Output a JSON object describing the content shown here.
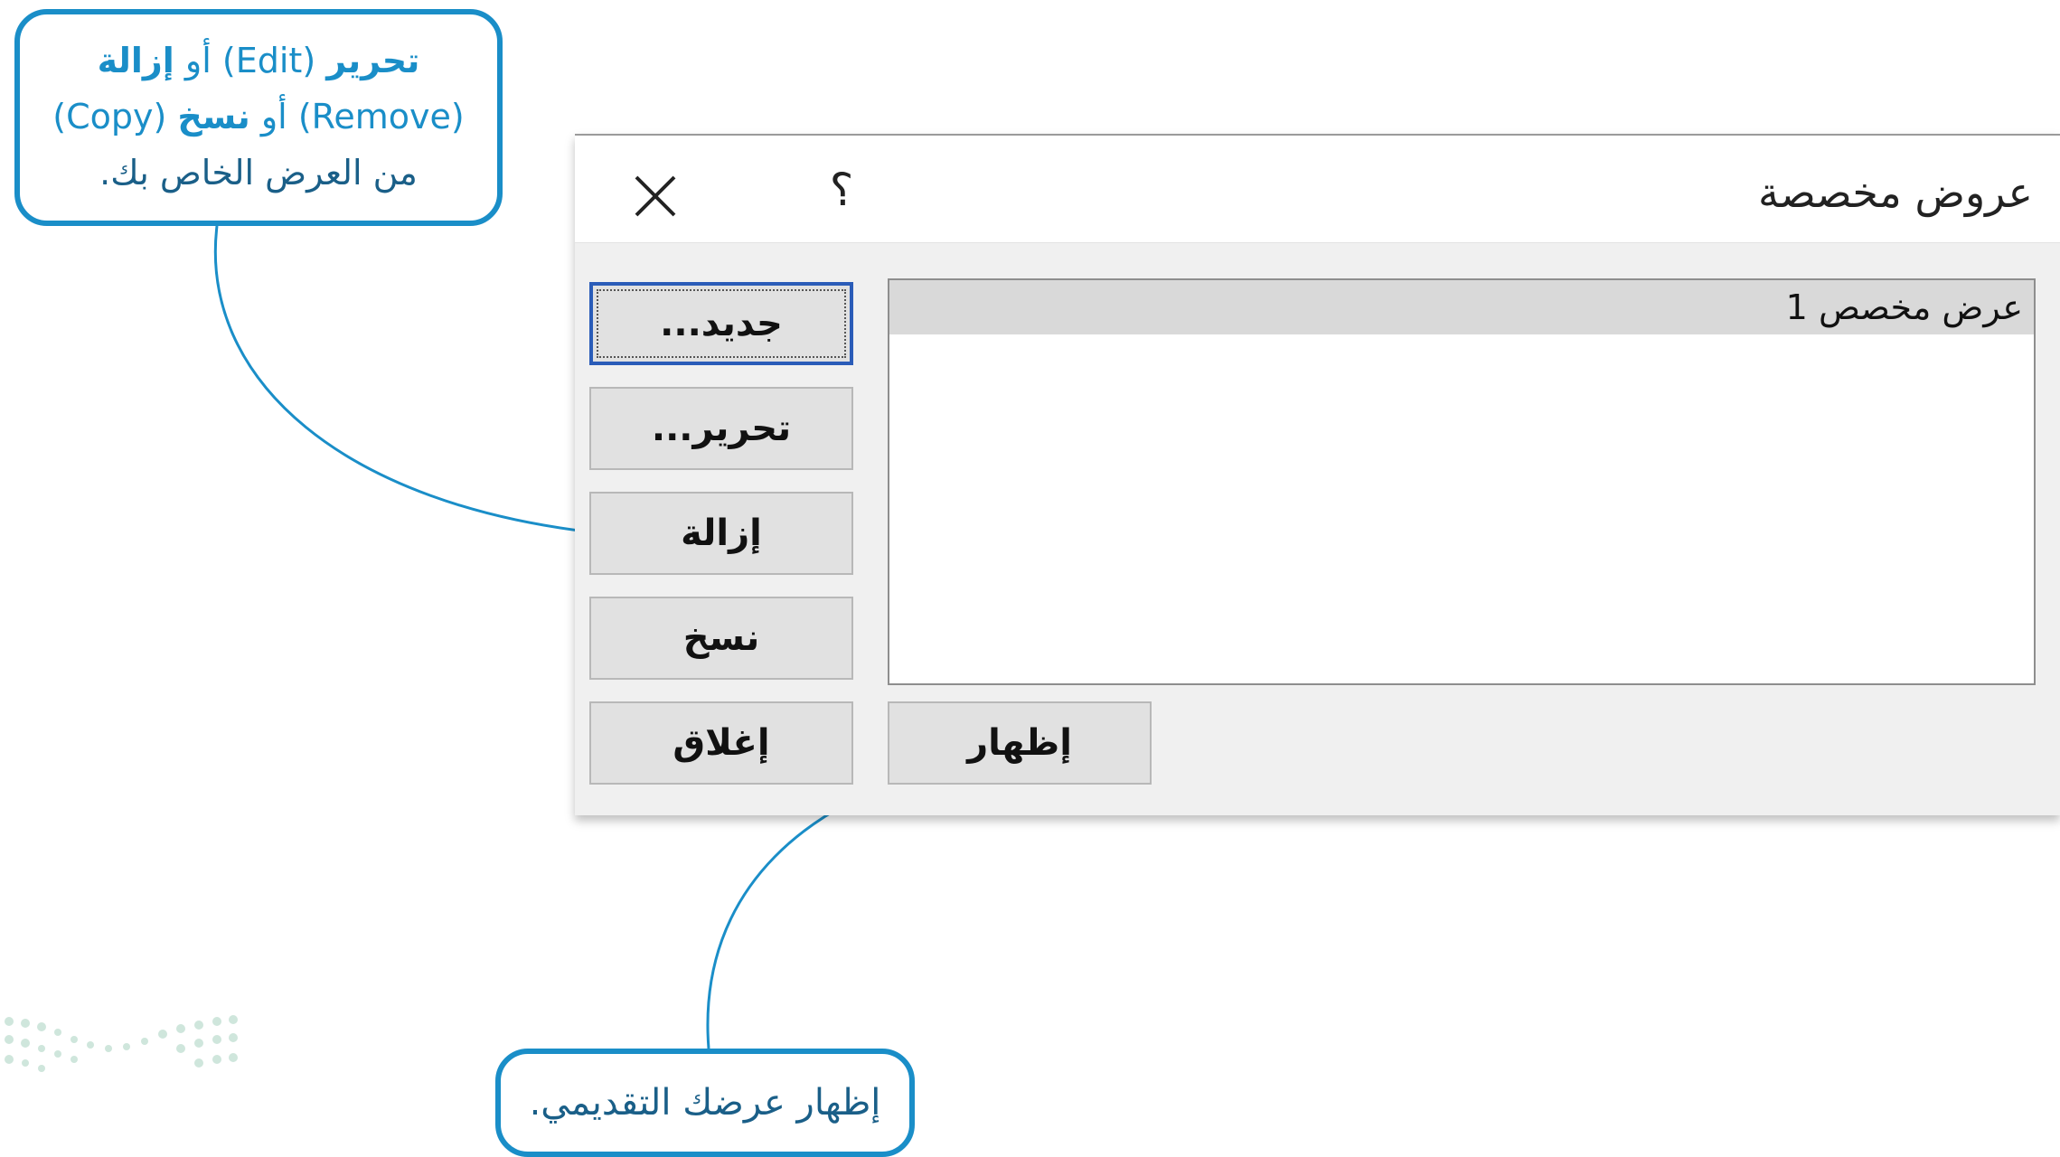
{
  "dialog": {
    "title": "عروض مخصصة",
    "help_label": "؟",
    "list_items": [
      "عرض مخصص 1"
    ],
    "buttons": {
      "new": "جديد...",
      "edit": "تحرير...",
      "remove": "إزالة",
      "copy": "نسخ",
      "close": "إغلاق",
      "show": "إظهار"
    }
  },
  "callouts": {
    "edit_remove_copy": {
      "line1_bold1": "تحرير",
      "line1_text": " (Edit) أو ",
      "line1_bold2": "إزالة",
      "line2_text1": "(Remove) أو ",
      "line2_bold": "نسخ",
      "line2_text2": " (Copy)",
      "line3": "من العرض الخاص بك."
    },
    "show": "إظهار عرضك التقديمي."
  },
  "colors": {
    "accent": "#1a8ec8",
    "dialog_bg": "#f0f0f0",
    "button_bg": "#e1e1e1",
    "selected_row": "#d9d9d9",
    "default_button_border": "#2a5cb8"
  },
  "icons": [
    "close-icon",
    "help-icon",
    "logo-dots-icon"
  ]
}
